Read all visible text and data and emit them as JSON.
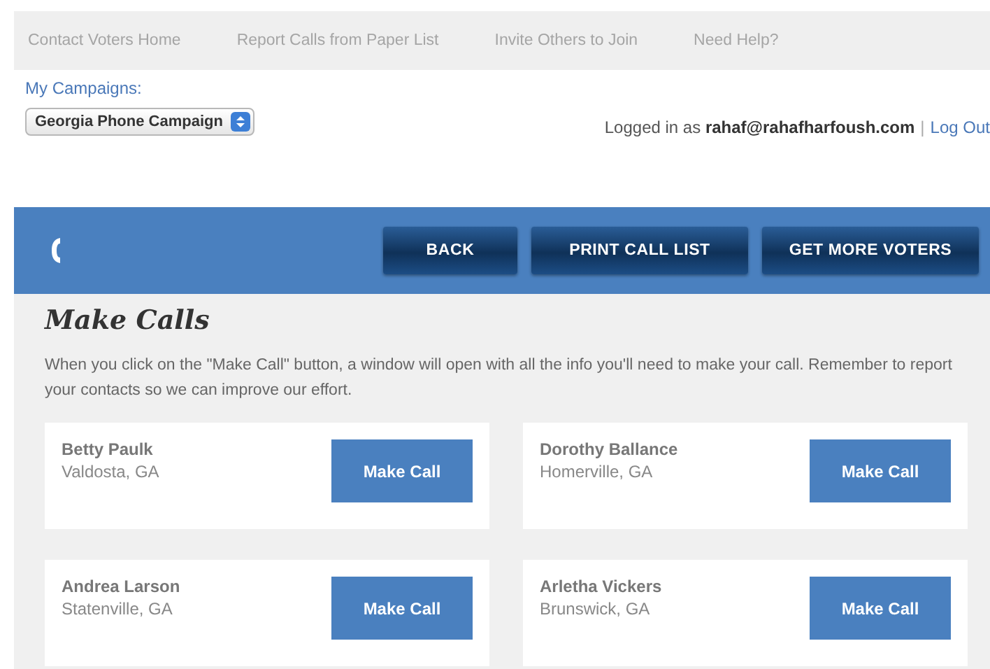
{
  "nav": [
    "Contact Voters Home",
    "Report Calls from Paper List",
    "Invite Others to Join",
    "Need Help?"
  ],
  "campaigns": {
    "label": "My Campaigns:",
    "value": "Georgia Phone Campaign"
  },
  "login": {
    "text": "Logged in as **rahaf@rahafharfoush.com**",
    "separator": "|",
    "link": "Log Out"
  },
  "toolbar": {
    "buttons": [
      "BACK",
      "PRINT CALL LIST",
      "GET MORE VOTERS"
    ]
  },
  "section": {
    "title": "Make Calls",
    "description": "When you click on the \"Make Call\" button, a window will open with all the info you'll need to make your call. Remember to report your contacts so we can improve our effort."
  },
  "voters": [
    {
      "name": "Betty Paulk",
      "place": "Valdosta, GA",
      "button": "Make Call"
    },
    {
      "name": "Dorothy Ballance",
      "place": "Homerville, GA",
      "button": "Make Call"
    },
    {
      "name": "Andrea Larson",
      "place": "Statenville, GA",
      "button": "Make Call"
    },
    {
      "name": "Arletha Vickers",
      "place": "Brunswick, GA",
      "button": "Make Call"
    }
  ]
}
